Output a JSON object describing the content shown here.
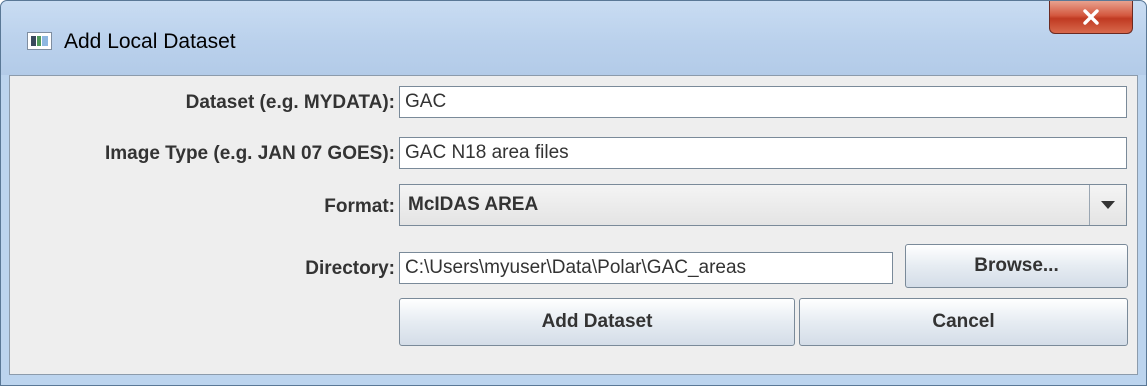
{
  "window": {
    "title": "Add Local Dataset",
    "icon": "app-window-icon",
    "close_icon": "close-icon"
  },
  "form": {
    "dataset": {
      "label": "Dataset (e.g. MYDATA):",
      "value": "GAC"
    },
    "image_type": {
      "label": "Image Type (e.g. JAN 07 GOES):",
      "value": "GAC N18 area files"
    },
    "format": {
      "label": "Format:",
      "selected": "McIDAS AREA",
      "arrow_icon": "dropdown-arrow-icon"
    },
    "directory": {
      "label": "Directory:",
      "value": "C:\\Users\\myuser\\Data\\Polar\\GAC_areas",
      "browse_label": "Browse..."
    }
  },
  "actions": {
    "add_label": "Add Dataset",
    "cancel_label": "Cancel"
  },
  "colors": {
    "title_bar": "#bcd4ee",
    "close_button": "#c9452b",
    "panel_background": "#eeeeee"
  }
}
